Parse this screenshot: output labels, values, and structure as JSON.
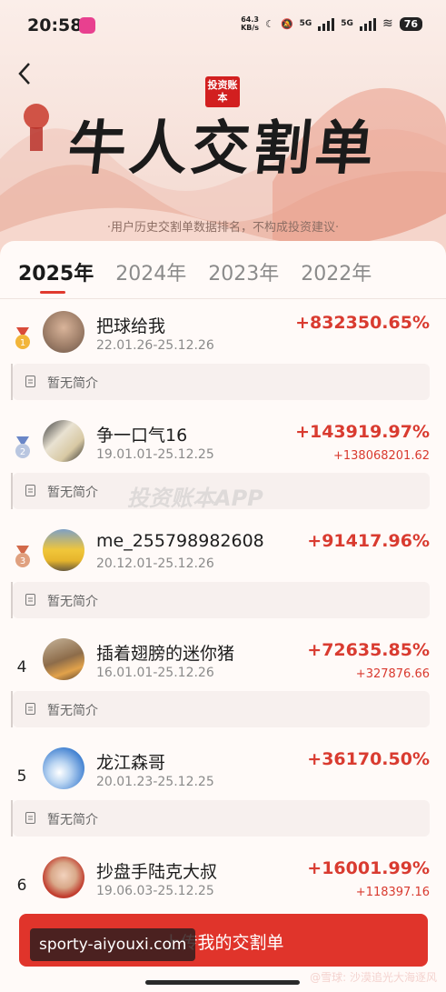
{
  "status_bar": {
    "time": "20:58",
    "net_speed_value": "64.3",
    "net_speed_unit": "KB/s",
    "network_1": "5G",
    "network_2": "5G",
    "battery": "76"
  },
  "hero": {
    "seal_text": "投资账本",
    "title": "牛人交割单",
    "subtitle": "·用户历史交割单数据排名，不构成投资建议·"
  },
  "tabs": [
    {
      "label": "2025年",
      "active": true
    },
    {
      "label": "2024年",
      "active": false
    },
    {
      "label": "2023年",
      "active": false
    },
    {
      "label": "2022年",
      "active": false
    }
  ],
  "entries": [
    {
      "rank": "1",
      "name": "把球给我",
      "dates": "22.01.26-25.12.26",
      "percent": "+832350.65%",
      "amount": "",
      "intro": "暂无简介",
      "medal": "gold"
    },
    {
      "rank": "2",
      "name": "争一口气16",
      "dates": "19.01.01-25.12.25",
      "percent": "+143919.97%",
      "amount": "+138068201.62",
      "intro": "暂无简介",
      "medal": "silver"
    },
    {
      "rank": "3",
      "name": "me_255798982608",
      "dates": "20.12.01-25.12.26",
      "percent": "+91417.96%",
      "amount": "",
      "intro": "暂无简介",
      "medal": "bronze"
    },
    {
      "rank": "4",
      "name": "插着翅膀的迷你猪",
      "dates": "16.01.01-25.12.26",
      "percent": "+72635.85%",
      "amount": "+327876.66",
      "intro": "暂无简介"
    },
    {
      "rank": "5",
      "name": "龙江森哥",
      "dates": "20.01.23-25.12.25",
      "percent": "+36170.50%",
      "amount": "",
      "intro": "暂无简介"
    },
    {
      "rank": "6",
      "name": "抄盘手陆克大叔",
      "dates": "19.06.03-25.12.25",
      "percent": "+16001.99%",
      "amount": "+118397.16",
      "intro": ""
    }
  ],
  "watermark": "投资账本APP",
  "cta_label": "上传我的交割单",
  "brand_overlay": "sporty-aiyouxi.com",
  "credit": "@雪球: 沙漠追光大海逐风",
  "colors": {
    "accent": "#e0342b",
    "profit": "#d93b30"
  }
}
